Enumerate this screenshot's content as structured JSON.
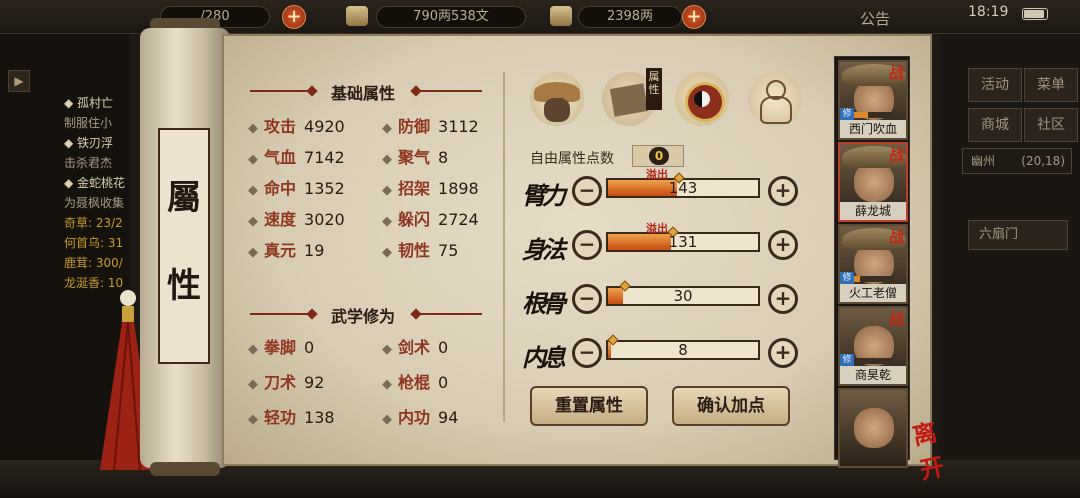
{
  "topbar": {
    "stamina": "/280",
    "silver": "790两538文",
    "gold": "2398两",
    "notice": "公告",
    "time": "18:19"
  },
  "quests": [
    {
      "text": "◆ 孤村亡",
      "style": "main"
    },
    {
      "text": "制服住小",
      "style": "sub"
    },
    {
      "text": "◆ 铁刃浮",
      "style": "main"
    },
    {
      "text": "击杀君杰",
      "style": "sub"
    },
    {
      "text": "◆ 金蛇桃花",
      "style": "main"
    },
    {
      "text": "为聂枫收集",
      "style": "sub"
    },
    {
      "text": "奇草: 23/2",
      "style": "hl"
    },
    {
      "text": "何首乌: 31",
      "style": "hl"
    },
    {
      "text": "鹿茸: 300/",
      "style": "hl"
    },
    {
      "text": "龙涎香: 10",
      "style": "hl"
    }
  ],
  "right_menu": {
    "buttons": [
      "活动",
      "菜单",
      "商城",
      "社区"
    ],
    "location": "幽州",
    "coords": "(20,18)",
    "faction": "六扇门"
  },
  "scroll": {
    "label_chars": [
      "屬",
      "性"
    ]
  },
  "basic": {
    "title": "基础属性",
    "left": [
      {
        "label": "攻击",
        "value": "4920"
      },
      {
        "label": "气血",
        "value": "7142"
      },
      {
        "label": "命中",
        "value": "1352"
      },
      {
        "label": "速度",
        "value": "3020"
      },
      {
        "label": "真元",
        "value": "19"
      }
    ],
    "right": [
      {
        "label": "防御",
        "value": "3112"
      },
      {
        "label": "聚气",
        "value": "8"
      },
      {
        "label": "招架",
        "value": "1898"
      },
      {
        "label": "躲闪",
        "value": "2724"
      },
      {
        "label": "韧性",
        "value": "75"
      }
    ]
  },
  "martial": {
    "title": "武学修为",
    "left": [
      {
        "label": "拳脚",
        "value": "0"
      },
      {
        "label": "刀术",
        "value": "92"
      },
      {
        "label": "轻功",
        "value": "138"
      }
    ],
    "right": [
      {
        "label": "剑术",
        "value": "0"
      },
      {
        "label": "枪棍",
        "value": "0"
      },
      {
        "label": "内功",
        "value": "94"
      }
    ]
  },
  "tabs": {
    "book_label": "属性"
  },
  "free_points": {
    "label": "自由属性点数",
    "value": "0"
  },
  "attributes": [
    {
      "name": "臂力",
      "value": "143",
      "fill": 0.46,
      "overflow": "溢出"
    },
    {
      "name": "身法",
      "value": "131",
      "fill": 0.42,
      "overflow": "溢出"
    },
    {
      "name": "根骨",
      "value": "30",
      "fill": 0.1,
      "overflow": ""
    },
    {
      "name": "内息",
      "value": "8",
      "fill": 0.02,
      "overflow": ""
    }
  ],
  "buttons": {
    "reset": "重置属性",
    "confirm": "确认加点"
  },
  "team": [
    {
      "name": "西门吹血",
      "zhan": "战",
      "xiu": "修",
      "progress": 0.35
    },
    {
      "name": "薛龙城",
      "zhan": "战",
      "xiu": "",
      "progress": 0
    },
    {
      "name": "火工老僧",
      "zhan": "战",
      "xiu": "修",
      "progress": 0.15
    },
    {
      "name": "商昊乾",
      "zhan": "战",
      "xiu": "修",
      "progress": 0
    },
    {
      "name": "",
      "zhan": "",
      "xiu": "",
      "progress": 0
    }
  ],
  "leave": "离开",
  "colors": {
    "accent_red": "#8e3722",
    "bar_fill": "#c54c13",
    "overflow": "#b12419"
  }
}
